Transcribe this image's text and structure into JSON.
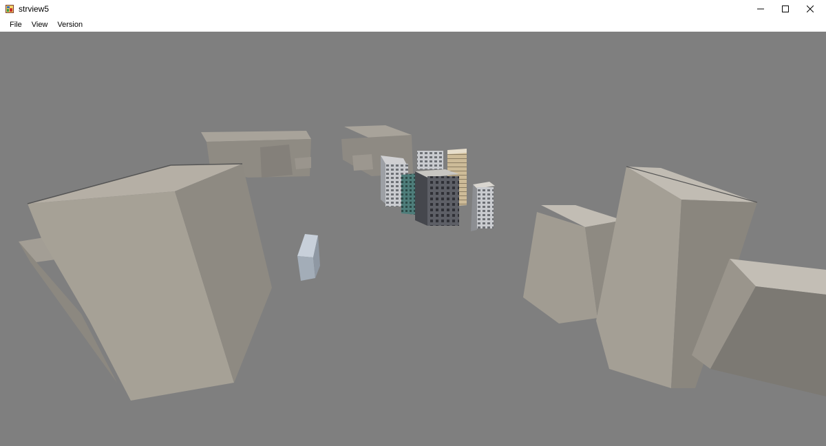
{
  "window": {
    "title": "strview5",
    "controls": {
      "minimize": "minimize",
      "maximize": "maximize",
      "close": "close"
    }
  },
  "menu": {
    "items": [
      {
        "label": "File"
      },
      {
        "label": "View"
      },
      {
        "label": "Version"
      }
    ]
  },
  "viewport": {
    "background_color": "#7f7f7f",
    "content": "3D city model rendering"
  }
}
